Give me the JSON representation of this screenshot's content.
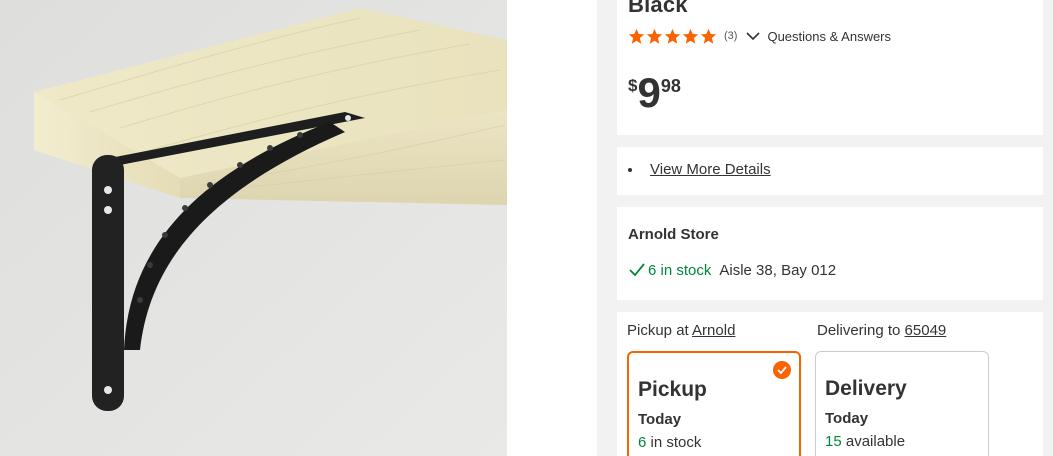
{
  "product": {
    "title_tail": "Black",
    "rating": {
      "stars": 5,
      "review_count": "(3)",
      "qa_label": "Questions & Answers"
    },
    "price": {
      "currency": "$",
      "dollars": "9",
      "cents": "98"
    }
  },
  "details": {
    "link_label": "View More Details"
  },
  "store": {
    "name": "Arnold Store",
    "stock": "6 in stock",
    "location": "Aisle 38, Bay 012"
  },
  "fulfillment": {
    "pickup_prefix": "Pickup at",
    "pickup_store": "Arnold",
    "delivery_prefix": "Delivering to",
    "delivery_zip": "65049",
    "pickup_card": {
      "title": "Pickup",
      "when": "Today",
      "count": "6",
      "suffix": "in stock"
    },
    "delivery_card": {
      "title": "Delivery",
      "when": "Today",
      "count": "15",
      "suffix": "available"
    }
  },
  "colors": {
    "accent": "#f96302",
    "in_stock": "#00873c",
    "star": "#f96302"
  }
}
